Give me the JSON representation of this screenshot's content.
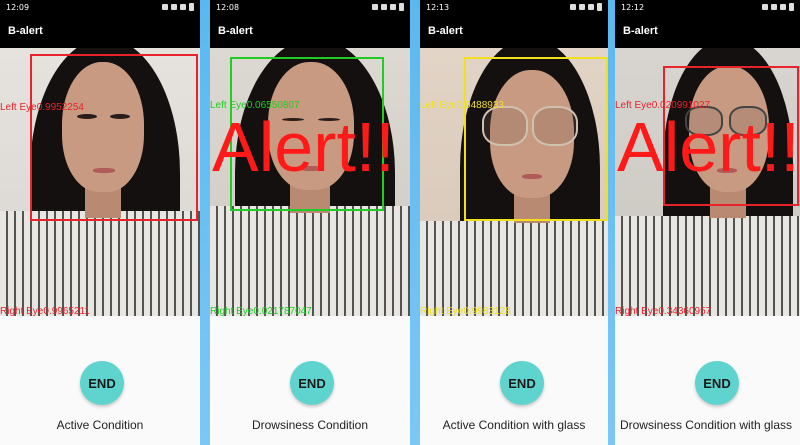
{
  "panels": [
    {
      "time": "12:09",
      "app_title": "B-alert",
      "left_eye_label": "Left Eye0.9952254",
      "right_eye_label": "Right Eye0.9965211",
      "alert": "",
      "button_label": "END",
      "caption": "Active Condition",
      "box_color": "#e8232b"
    },
    {
      "time": "12:08",
      "app_title": "B-alert",
      "left_eye_label": "Left Eye0.06550807",
      "right_eye_label": "Right Eye0.021787047",
      "alert": "Alert!!",
      "button_label": "END",
      "caption": "Drowsiness Condition",
      "box_color": "#22cc22"
    },
    {
      "time": "12:13",
      "app_title": "B-alert",
      "left_eye_label": "Left Eye0.9488933",
      "right_eye_label": "Right Eye0.9983128",
      "alert": "",
      "button_label": "END",
      "caption": "Active Condition with glass",
      "box_color": "#f0e020"
    },
    {
      "time": "12:12",
      "app_title": "B-alert",
      "left_eye_label": "Left Eye0.020991027",
      "right_eye_label": "Right Eye0.34360957",
      "alert": "Alert!!",
      "button_label": "END",
      "caption": "Drowsiness Condition with glass",
      "box_color": "#e8232b"
    }
  ]
}
